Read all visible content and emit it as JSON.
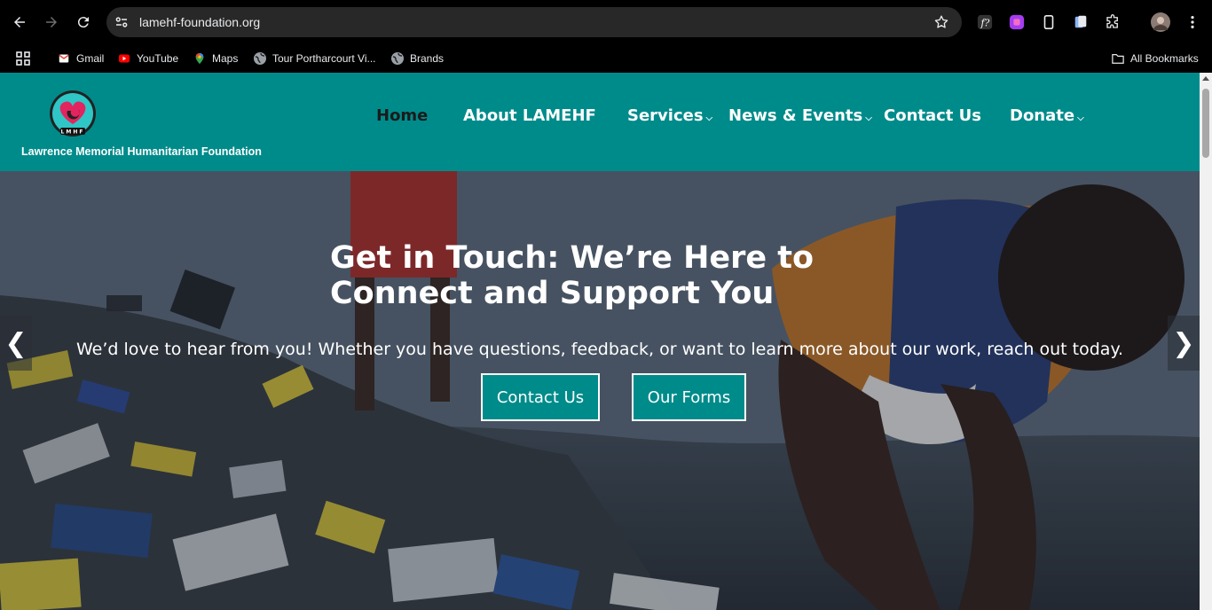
{
  "browser": {
    "url": "lamehf-foundation.org",
    "bookmarks": [
      {
        "label": "Gmail",
        "icon": "gmail-icon"
      },
      {
        "label": "YouTube",
        "icon": "youtube-icon"
      },
      {
        "label": "Maps",
        "icon": "maps-icon"
      },
      {
        "label": "Tour Portharcourt Vi...",
        "icon": "globe-icon"
      },
      {
        "label": "Brands",
        "icon": "globe-icon"
      }
    ],
    "all_bookmarks_label": "All Bookmarks"
  },
  "site": {
    "brand_name": "Lawrence Memorial Humanitarian Foundation",
    "logo_text": "LMHF",
    "accent_color": "#008b8b",
    "menu": [
      {
        "label": "Home",
        "active": true,
        "has_dropdown": false
      },
      {
        "label": "About LAMEHF",
        "active": false,
        "has_dropdown": false
      },
      {
        "label": "Services",
        "active": false,
        "has_dropdown": true
      },
      {
        "label": "News & Events",
        "active": false,
        "has_dropdown": true
      },
      {
        "label": "Contact Us",
        "active": false,
        "has_dropdown": false
      },
      {
        "label": "Donate",
        "active": false,
        "has_dropdown": true
      }
    ]
  },
  "hero": {
    "title": "Get in Touch: We’re Here to Connect and Support You",
    "subtitle": "We’d love to hear from you! Whether you have questions, feedback, or want to learn more about our work, reach out today.",
    "buttons": [
      "Contact Us",
      "Our Forms"
    ],
    "prev_arrow": "❮",
    "next_arrow": "❯"
  }
}
